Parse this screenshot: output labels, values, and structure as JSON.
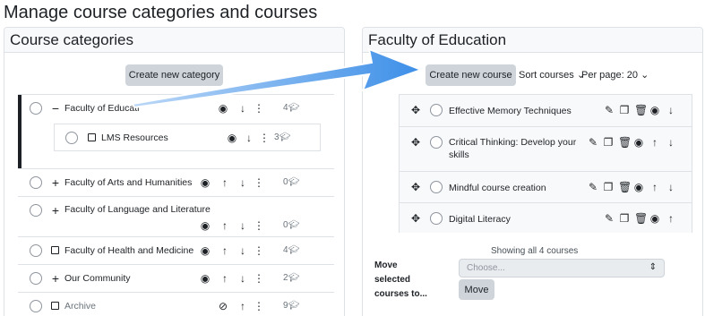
{
  "page": {
    "title": "Manage course categories and courses"
  },
  "left_panel": {
    "title": "Course categories",
    "create_button": "Create new category",
    "categories": [
      {
        "name": "Faculty of Educati",
        "expander": "−",
        "count": "4",
        "has_up": false,
        "hidden": false
      },
      {
        "name": "LMS Resources",
        "expander": "box",
        "count": "3",
        "has_up": false,
        "hidden": false
      },
      {
        "name": "Faculty of Arts and Humanities",
        "expander": "+",
        "count": "0",
        "has_up": true,
        "hidden": false
      },
      {
        "name": "Faculty of Language and Literature",
        "expander": "+",
        "count": "0",
        "has_up": true,
        "hidden": false
      },
      {
        "name": "Faculty of Health and Medicine",
        "expander": "box",
        "count": "4",
        "has_up": true,
        "hidden": false
      },
      {
        "name": "Our Community",
        "expander": "+",
        "count": "2",
        "has_up": true,
        "hidden": false
      },
      {
        "name": "Archive",
        "expander": "box",
        "count": "9",
        "has_up": true,
        "hidden": true
      }
    ]
  },
  "right_panel": {
    "title": "Faculty of Education",
    "create_button": "Create new course",
    "sort_label": "Sort courses",
    "perpage_label": "Per page: 20",
    "courses": [
      {
        "name": "Effective Memory Techniques"
      },
      {
        "name": "Critical Thinking: Develop your skills"
      },
      {
        "name": "Mindful course creation"
      },
      {
        "name": "Digital Literacy"
      }
    ],
    "showing": "Showing all 4 courses",
    "move_label": "Move selected courses to...",
    "select_placeholder": "Choose...",
    "move_button": "Move"
  },
  "colors": {
    "arrow": "#3d8fe8",
    "active_bar": "#1d2125"
  },
  "icons": {
    "hide": "eye-icon",
    "unhide": "eye-slash-icon",
    "up": "arrow-up-icon",
    "down": "arrow-down-icon",
    "menu": "kebab-menu-icon",
    "courses": "graduation-cap-icon",
    "edit": "pencil-icon",
    "copy": "copy-icon",
    "delete": "trash-icon",
    "drag": "move-icon"
  }
}
